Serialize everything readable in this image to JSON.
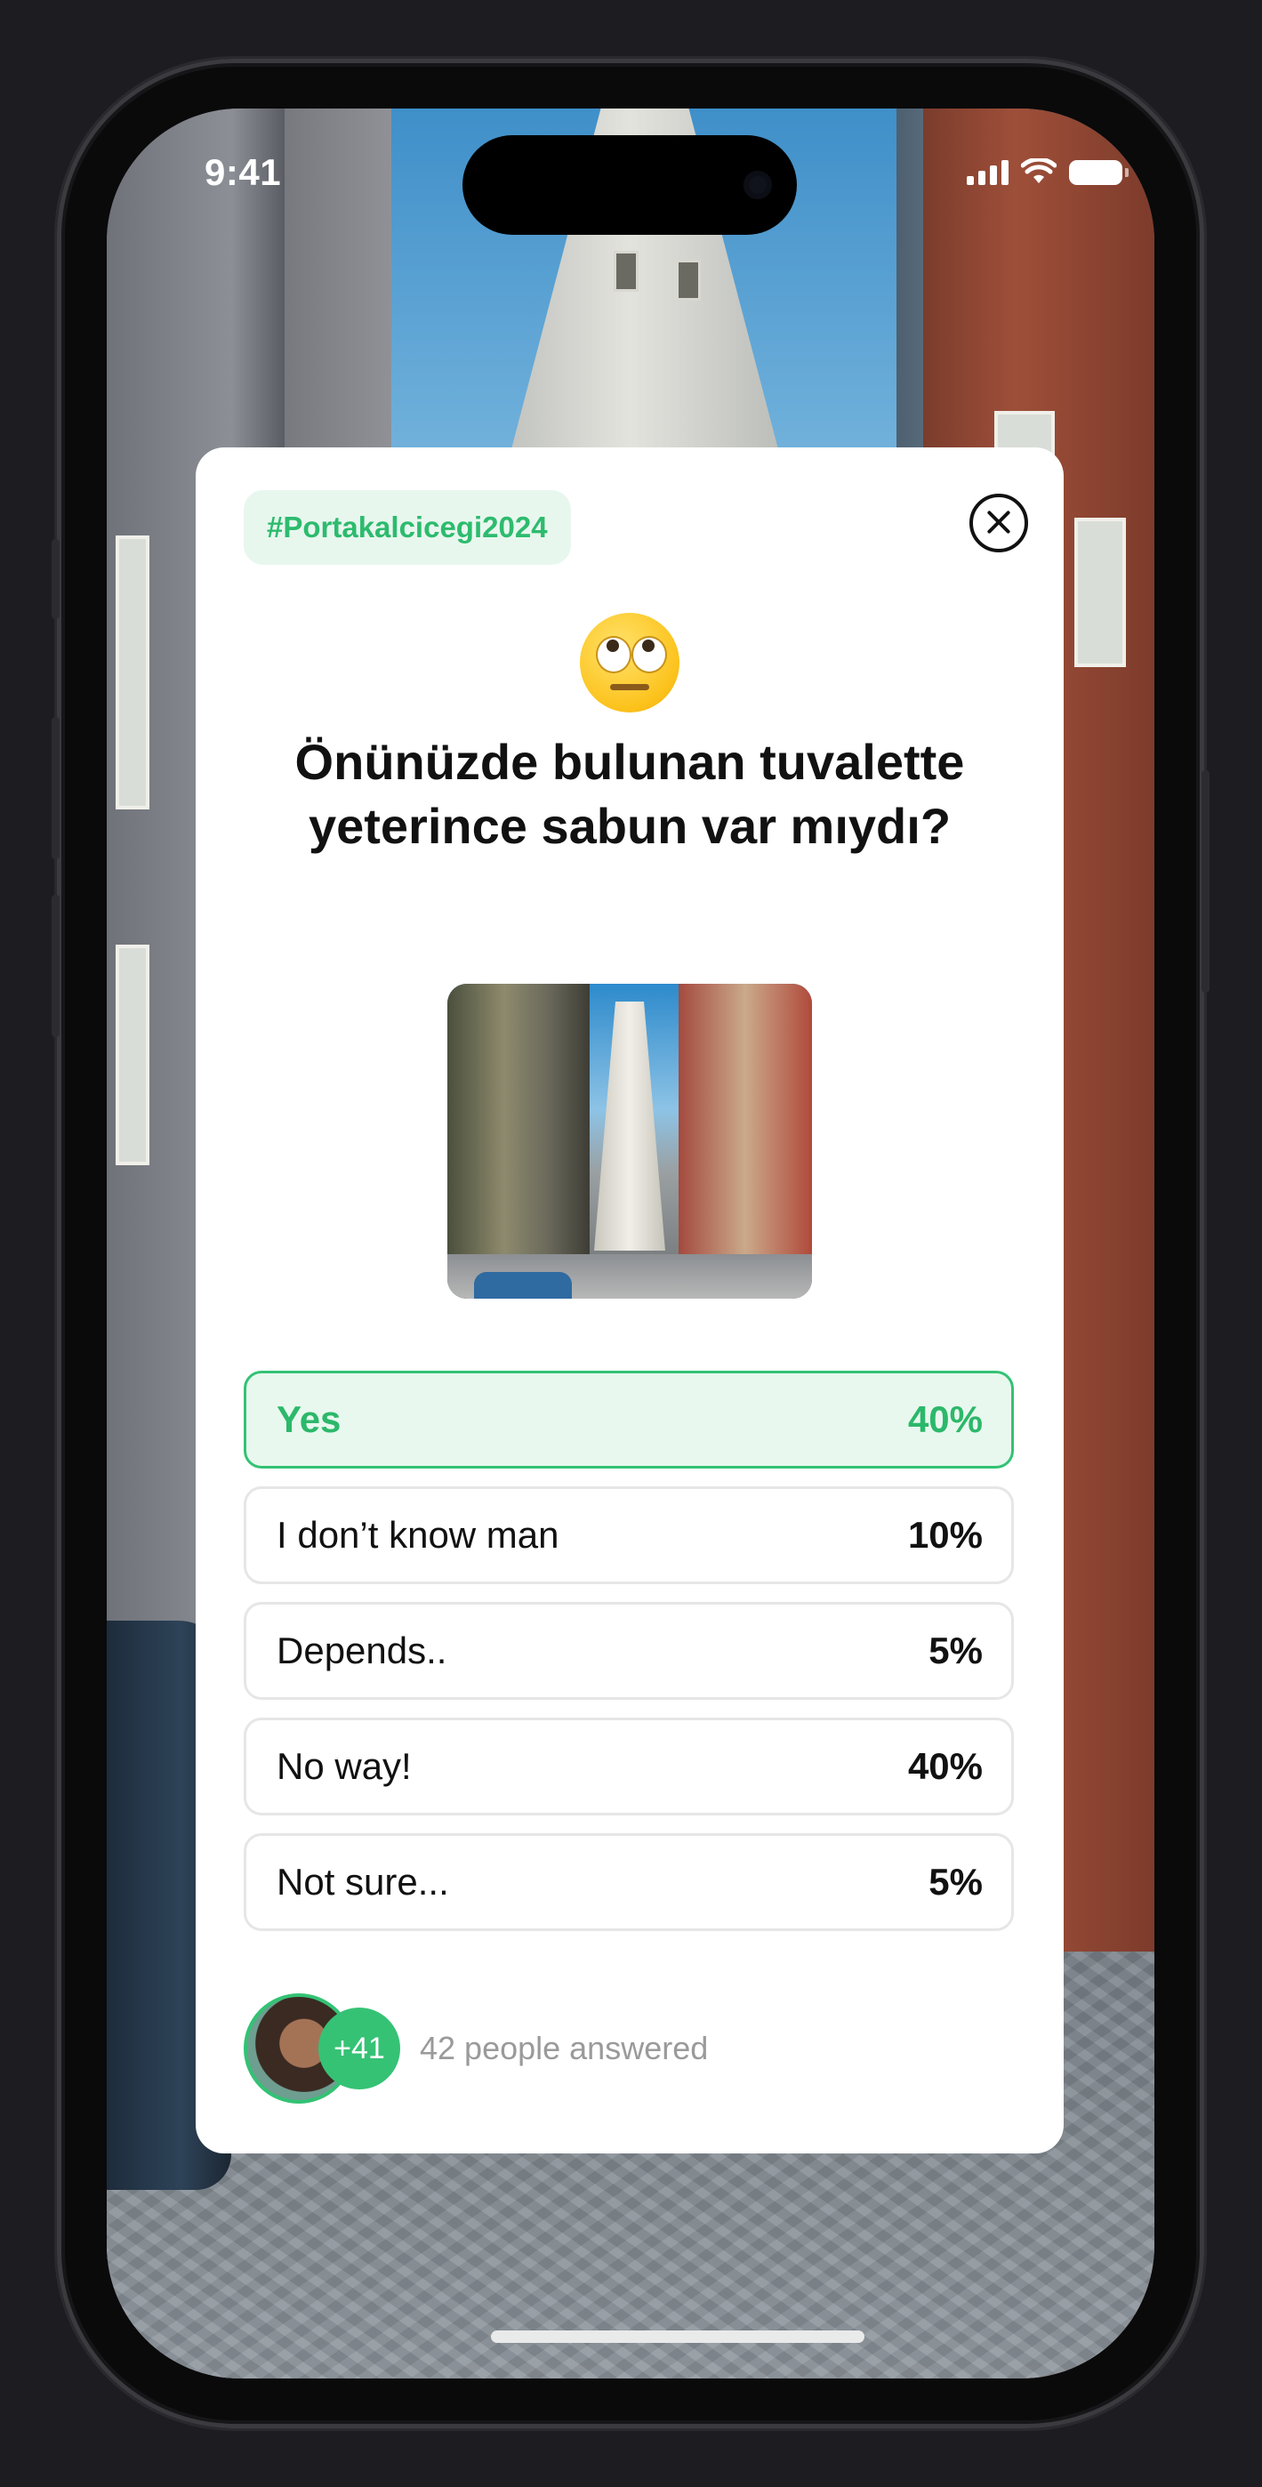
{
  "status_bar": {
    "time": "9:41"
  },
  "poll": {
    "tag": "#Portakalcicegi2024",
    "emoji": "eye-roll-emoji",
    "question": "Önünüzde bulunan tuvalette yeterince sabun var mıydı?",
    "options": [
      {
        "label": "Yes",
        "percent": "40%",
        "selected": true
      },
      {
        "label": "I don’t know man",
        "percent": "10%",
        "selected": false
      },
      {
        "label": "Depends..",
        "percent": "5%",
        "selected": false
      },
      {
        "label": "No way!",
        "percent": "40%",
        "selected": false
      },
      {
        "label": "Not sure...",
        "percent": "5%",
        "selected": false
      }
    ],
    "more_count": "+41",
    "answered_text": "42 people answered"
  },
  "colors": {
    "accent": "#33c274",
    "accent_light": "#e9f8ef",
    "card": "#ffffff"
  }
}
